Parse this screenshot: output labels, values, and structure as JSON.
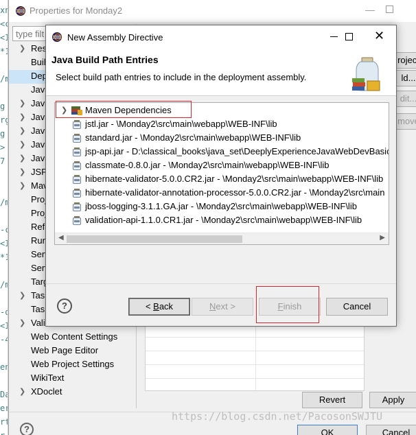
{
  "editor_strip": {
    "lines": [
      "xn",
      "<c",
      "<I",
      "*1",
      "",
      "/m",
      "",
      "g",
      "rg",
      "g",
      ">",
      "7",
      "",
      "",
      "/m",
      "",
      "-c",
      "<I",
      "*1",
      "",
      "/m",
      "",
      "-o",
      "<I",
      "-4",
      "",
      "en",
      "",
      "Da",
      "er",
      "rt",
      "r-"
    ]
  },
  "outer_window": {
    "title": "Properties for Monday2",
    "filter_placeholder": "type filt",
    "tree": [
      {
        "label": "Reso",
        "arrow": true
      },
      {
        "label": "Build",
        "arrow": false
      },
      {
        "label": "Depl",
        "arrow": false,
        "selected": true
      },
      {
        "label": "Java",
        "arrow": false
      },
      {
        "label": "Java",
        "arrow": true
      },
      {
        "label": "Java",
        "arrow": true
      },
      {
        "label": "Java",
        "arrow": true
      },
      {
        "label": "Java",
        "arrow": true
      },
      {
        "label": "Java",
        "arrow": true
      },
      {
        "label": "JSP",
        "arrow": true
      },
      {
        "label": "Mav",
        "arrow": true
      },
      {
        "label": "Proj",
        "arrow": false
      },
      {
        "label": "Proj",
        "arrow": false
      },
      {
        "label": "Refa",
        "arrow": false
      },
      {
        "label": "Run/",
        "arrow": false
      },
      {
        "label": "Serv",
        "arrow": false
      },
      {
        "label": "Serv",
        "arrow": false
      },
      {
        "label": "Targ",
        "arrow": false
      },
      {
        "label": "Task",
        "arrow": true
      },
      {
        "label": "Task",
        "arrow": false
      },
      {
        "label": "Validation",
        "arrow": true
      },
      {
        "label": "Web Content Settings",
        "arrow": false
      },
      {
        "label": "Web Page Editor",
        "arrow": false
      },
      {
        "label": "Web Project Settings",
        "arrow": false
      },
      {
        "label": "WikiText",
        "arrow": false
      },
      {
        "label": "XDoclet",
        "arrow": true
      }
    ],
    "right_buttons": [
      "roject",
      "ld...",
      "dit...",
      "move"
    ],
    "revert_label": "Revert",
    "apply_label": "Apply",
    "ok_label": "OK",
    "cancel_label": "Cancel",
    "watermark": "https://blog.csdn.net/PacosonSWJTU"
  },
  "dialog": {
    "title": "New Assembly Directive",
    "heading": "Java Build Path Entries",
    "description": "Select build path entries to include in the deployment assembly.",
    "entries": [
      {
        "label": "Maven Dependencies",
        "type": "library",
        "expandable": true
      },
      {
        "label": "jstl.jar - \\Monday2\\src\\main\\webapp\\WEB-INF\\lib",
        "type": "jar"
      },
      {
        "label": "standard.jar - \\Monday2\\src\\main\\webapp\\WEB-INF\\lib",
        "type": "jar"
      },
      {
        "label": "jsp-api.jar - D:\\classical_books\\java_set\\DeeplyExperienceJavaWebDevBasic\\",
        "type": "jar"
      },
      {
        "label": "classmate-0.8.0.jar - \\Monday2\\src\\main\\webapp\\WEB-INF\\lib",
        "type": "jar"
      },
      {
        "label": "hibernate-validator-5.0.0.CR2.jar - \\Monday2\\src\\main\\webapp\\WEB-INF\\lib",
        "type": "jar"
      },
      {
        "label": "hibernate-validator-annotation-processor-5.0.0.CR2.jar - \\Monday2\\src\\main",
        "type": "jar"
      },
      {
        "label": "jboss-logging-3.1.1.GA.jar - \\Monday2\\src\\main\\webapp\\WEB-INF\\lib",
        "type": "jar"
      },
      {
        "label": "validation-api-1.1.0.CR1.jar - \\Monday2\\src\\main\\webapp\\WEB-INF\\lib",
        "type": "jar"
      }
    ],
    "buttons": {
      "back": {
        "before": "< ",
        "mnemonic": "B",
        "after": "ack",
        "enabled": true
      },
      "next": {
        "before": "",
        "mnemonic": "N",
        "after": "ext >",
        "enabled": false
      },
      "finish": {
        "before": "",
        "mnemonic": "F",
        "after": "inish",
        "enabled": false
      },
      "cancel": {
        "label": "Cancel",
        "enabled": true
      }
    }
  },
  "colors": {
    "highlight_box": "#d9262c",
    "selection": "#cce4f7",
    "window_bg": "#f0f0f0"
  }
}
